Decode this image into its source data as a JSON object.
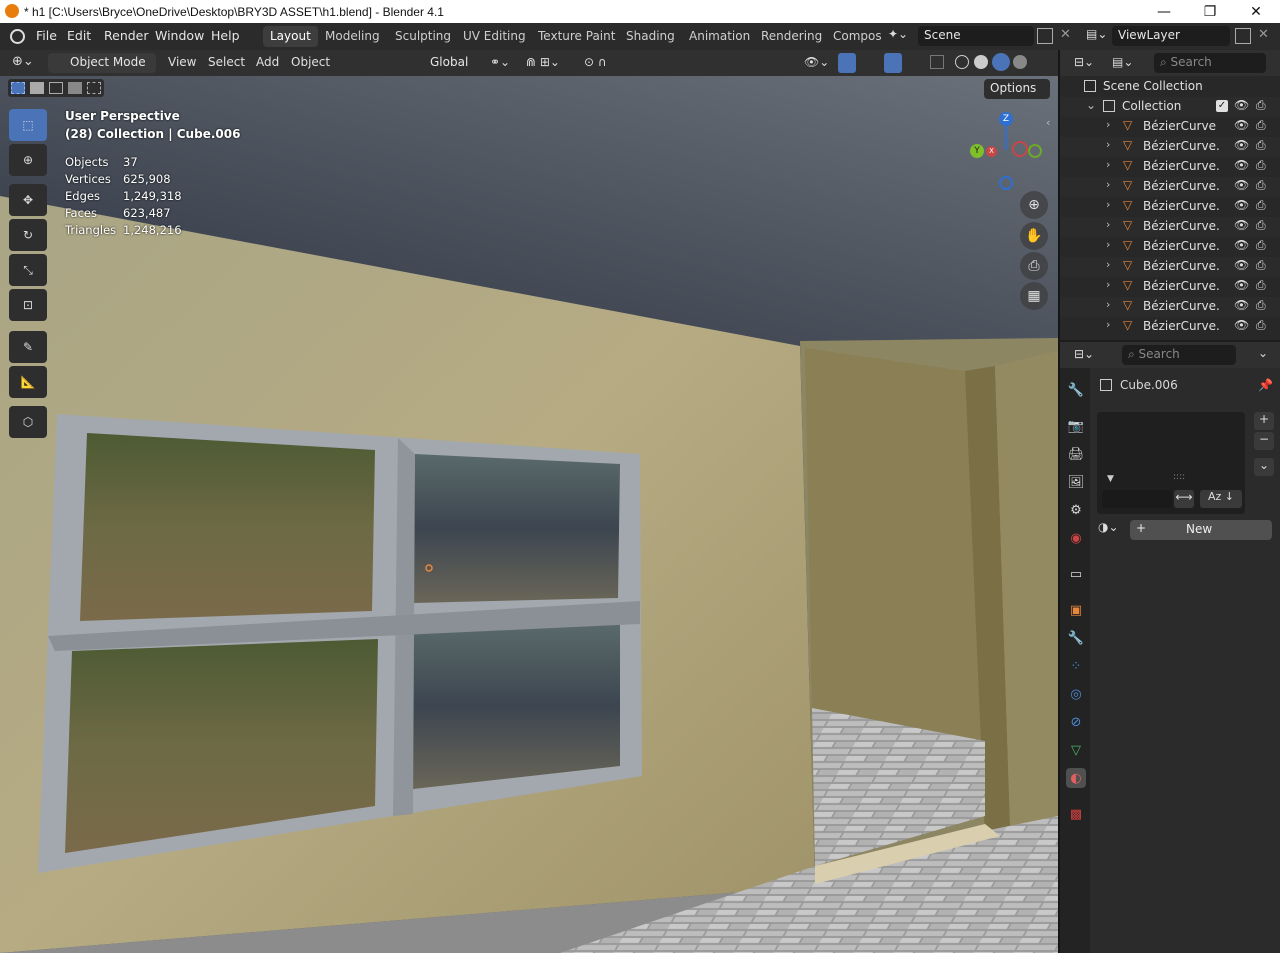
{
  "window": {
    "title": "* h1 [C:\\Users\\Bryce\\OneDrive\\Desktop\\BRY3D ASSET\\h1.blend] - Blender 4.1",
    "minimize": "—",
    "maximize": "❐",
    "close": "✕"
  },
  "menubar": {
    "items": [
      "File",
      "Edit",
      "Render",
      "Window",
      "Help"
    ]
  },
  "workspaces": {
    "tabs": [
      "Layout",
      "Modeling",
      "Sculpting",
      "UV Editing",
      "Texture Paint",
      "Shading",
      "Animation",
      "Rendering",
      "Compos"
    ],
    "active": "Layout"
  },
  "scene": {
    "label": "Scene"
  },
  "viewlayer": {
    "label": "ViewLayer"
  },
  "viewport_header": {
    "mode": "Object Mode",
    "menus": [
      "View",
      "Select",
      "Add",
      "Object"
    ],
    "transform_orientation": "Global",
    "options": "Options"
  },
  "viewport": {
    "perspective": "User Perspective",
    "collection_info": "(28) Collection | Cube.006",
    "stats": [
      {
        "label": "Objects",
        "value": "37"
      },
      {
        "label": "Vertices",
        "value": "625,908"
      },
      {
        "label": "Edges",
        "value": "1,249,318"
      },
      {
        "label": "Faces",
        "value": "623,487"
      },
      {
        "label": "Triangles",
        "value": "1,248,216"
      }
    ],
    "gizmo": {
      "z": "Z",
      "y": "Y",
      "x": "X"
    }
  },
  "outliner": {
    "search_placeholder": "Search",
    "scene_collection": "Scene Collection",
    "collection": "Collection",
    "items": [
      "BézierCurve",
      "BézierCurve.",
      "BézierCurve.",
      "BézierCurve.",
      "BézierCurve.",
      "BézierCurve.",
      "BézierCurve.",
      "BézierCurve.",
      "BézierCurve.",
      "BézierCurve.",
      "BézierCurve."
    ]
  },
  "properties": {
    "search_placeholder": "Search",
    "object_name": "Cube.006",
    "new_button": "New",
    "sort_label": "Az"
  },
  "colors": {
    "accent": "#4a73b8",
    "curve_icon": "#e8873a",
    "wall": "#b8ad84"
  }
}
